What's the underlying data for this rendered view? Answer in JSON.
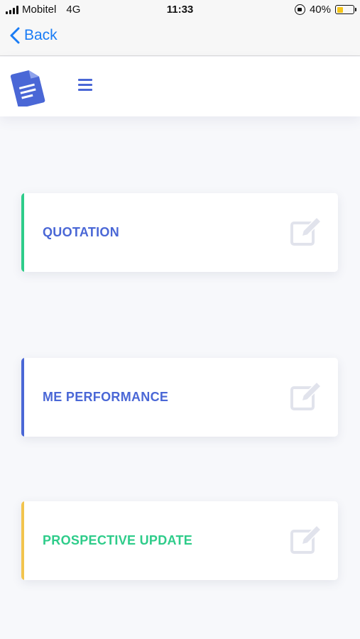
{
  "status_bar": {
    "carrier": "Mobitel",
    "network": "4G",
    "time": "11:33",
    "battery": "40%",
    "battery_level": 0.4
  },
  "nav": {
    "back_label": "Back"
  },
  "header": {
    "logo_icon": "document-icon",
    "menu_icon": "hamburger-menu-icon"
  },
  "cards": [
    {
      "title": "QUOTATION",
      "accent": "#2ecc8a",
      "title_color": "#4a67d6",
      "icon": "edit-icon"
    },
    {
      "title": "ME PERFORMANCE",
      "accent": "#4a67d6",
      "title_color": "#4a67d6",
      "icon": "edit-icon"
    },
    {
      "title": "PROSPECTIVE UPDATE",
      "accent": "#f2c44e",
      "title_color": "#2ecc8a",
      "icon": "edit-icon"
    }
  ],
  "colors": {
    "brand_blue": "#4a67d6",
    "ios_link": "#1a7cf5",
    "edit_icon": "#e1e3ec"
  }
}
